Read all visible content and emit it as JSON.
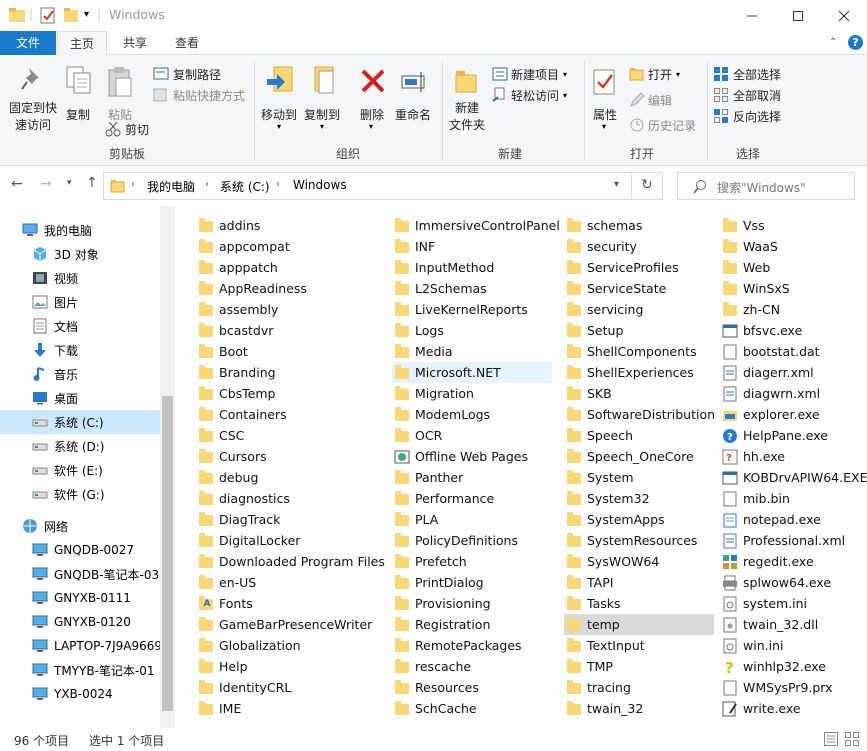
{
  "window": {
    "title": "Windows"
  },
  "ribbon_tabs": [
    "文件",
    "主页",
    "共享",
    "查看"
  ],
  "ribbon": {
    "clipboard": {
      "pin": "固定到快\n速访问",
      "copy": "复制",
      "paste": "粘贴",
      "copy_path": "复制路径",
      "paste_shortcut": "粘贴快捷方式",
      "cut": "剪切",
      "group": "剪贴板"
    },
    "organize": {
      "move_to": "移动到",
      "copy_to": "复制到",
      "delete": "删除",
      "rename": "重命名",
      "group": "组织"
    },
    "new": {
      "new_item": "新建项目",
      "easy_access": "轻松访问",
      "new_folder": "新建\n文件夹",
      "group": "新建"
    },
    "open": {
      "properties": "属性",
      "open": "打开",
      "edit": "编辑",
      "history": "历史记录",
      "group": "打开"
    },
    "select": {
      "select_all": "全部选择",
      "select_none": "全部取消",
      "invert": "反向选择",
      "group": "选择"
    }
  },
  "address": {
    "path": [
      "我的电脑",
      "系统 (C:)",
      "Windows"
    ],
    "search_placeholder": "搜索\"Windows\""
  },
  "nav": [
    {
      "label": "我的电脑",
      "icon": "computer-icon",
      "level": 0
    },
    {
      "label": "3D 对象",
      "icon": "cube-icon",
      "level": 1
    },
    {
      "label": "视频",
      "icon": "video-icon",
      "level": 1
    },
    {
      "label": "图片",
      "icon": "picture-icon",
      "level": 1
    },
    {
      "label": "文档",
      "icon": "document-icon",
      "level": 1
    },
    {
      "label": "下载",
      "icon": "download-icon",
      "level": 1
    },
    {
      "label": "音乐",
      "icon": "music-icon",
      "level": 1
    },
    {
      "label": "桌面",
      "icon": "desktop-icon",
      "level": 1
    },
    {
      "label": "系统 (C:)",
      "icon": "drive-icon",
      "level": 1,
      "selected": true
    },
    {
      "label": "系统 (D:)",
      "icon": "drive-icon",
      "level": 1
    },
    {
      "label": "软件 (E:)",
      "icon": "drive-icon",
      "level": 1
    },
    {
      "label": "软件 (G:)",
      "icon": "drive-icon",
      "level": 1
    },
    {
      "label": "网络",
      "icon": "network-icon",
      "level": 0
    },
    {
      "label": "GNQDB-0027",
      "icon": "computer-icon",
      "level": 1
    },
    {
      "label": "GNQDB-笔记本-03",
      "icon": "computer-icon",
      "level": 1
    },
    {
      "label": "GNYXB-0111",
      "icon": "computer-icon",
      "level": 1
    },
    {
      "label": "GNYXB-0120",
      "icon": "computer-icon",
      "level": 1
    },
    {
      "label": "LAPTOP-7J9A9669",
      "icon": "computer-icon",
      "level": 1
    },
    {
      "label": "TMYYB-笔记本-01",
      "icon": "computer-icon",
      "level": 1
    },
    {
      "label": "YXB-0024",
      "icon": "computer-icon",
      "level": 1
    }
  ],
  "files": [
    [
      "addins",
      "appcompat",
      "apppatch",
      "AppReadiness",
      "assembly",
      "bcastdvr",
      "Boot",
      "Branding",
      "CbsTemp",
      "Containers",
      "CSC",
      "Cursors",
      "debug",
      "diagnostics",
      "DiagTrack",
      "DigitalLocker",
      "Downloaded Program Files",
      "en-US",
      "Fonts",
      "GameBarPresenceWriter",
      "Globalization",
      "Help",
      "IdentityCRL",
      "IME"
    ],
    [
      "ImmersiveControlPanel",
      "INF",
      "InputMethod",
      "L2Schemas",
      "LiveKernelReports",
      "Logs",
      "Media",
      "Microsoft.NET",
      "Migration",
      "ModemLogs",
      "OCR",
      "Offline Web Pages",
      "Panther",
      "Performance",
      "PLA",
      "PolicyDefinitions",
      "Prefetch",
      "PrintDialog",
      "Provisioning",
      "Registration",
      "RemotePackages",
      "rescache",
      "Resources",
      "SchCache"
    ],
    [
      "schemas",
      "security",
      "ServiceProfiles",
      "ServiceState",
      "servicing",
      "Setup",
      "ShellComponents",
      "ShellExperiences",
      "SKB",
      "SoftwareDistribution",
      "Speech",
      "Speech_OneCore",
      "System",
      "System32",
      "SystemApps",
      "SystemResources",
      "SysWOW64",
      "TAPI",
      "Tasks",
      "temp",
      "TextInput",
      "TMP",
      "tracing",
      "twain_32"
    ],
    [
      "Vss",
      "WaaS",
      "Web",
      "WinSxS",
      "zh-CN",
      "bfsvc.exe",
      "bootstat.dat",
      "diagerr.xml",
      "diagwrn.xml",
      "explorer.exe",
      "HelpPane.exe",
      "hh.exe",
      "KOBDrvAPIW64.EXE",
      "mib.bin",
      "notepad.exe",
      "Professional.xml",
      "regedit.exe",
      "splwow64.exe",
      "system.ini",
      "twain_32.dll",
      "win.ini",
      "winhlp32.exe",
      "WMSysPr9.prx",
      "write.exe"
    ]
  ],
  "file_count_folders_col4": 5,
  "selected_file": "temp",
  "hover_file": "Microsoft.NET",
  "status": {
    "count": "96 个项目",
    "selected": "选中 1 个项目"
  },
  "colors": {
    "accent": "#1979ca",
    "selected_bg": "#cce8ff",
    "hover_bg": "#e5f3ff",
    "folder": "#f8d775"
  }
}
